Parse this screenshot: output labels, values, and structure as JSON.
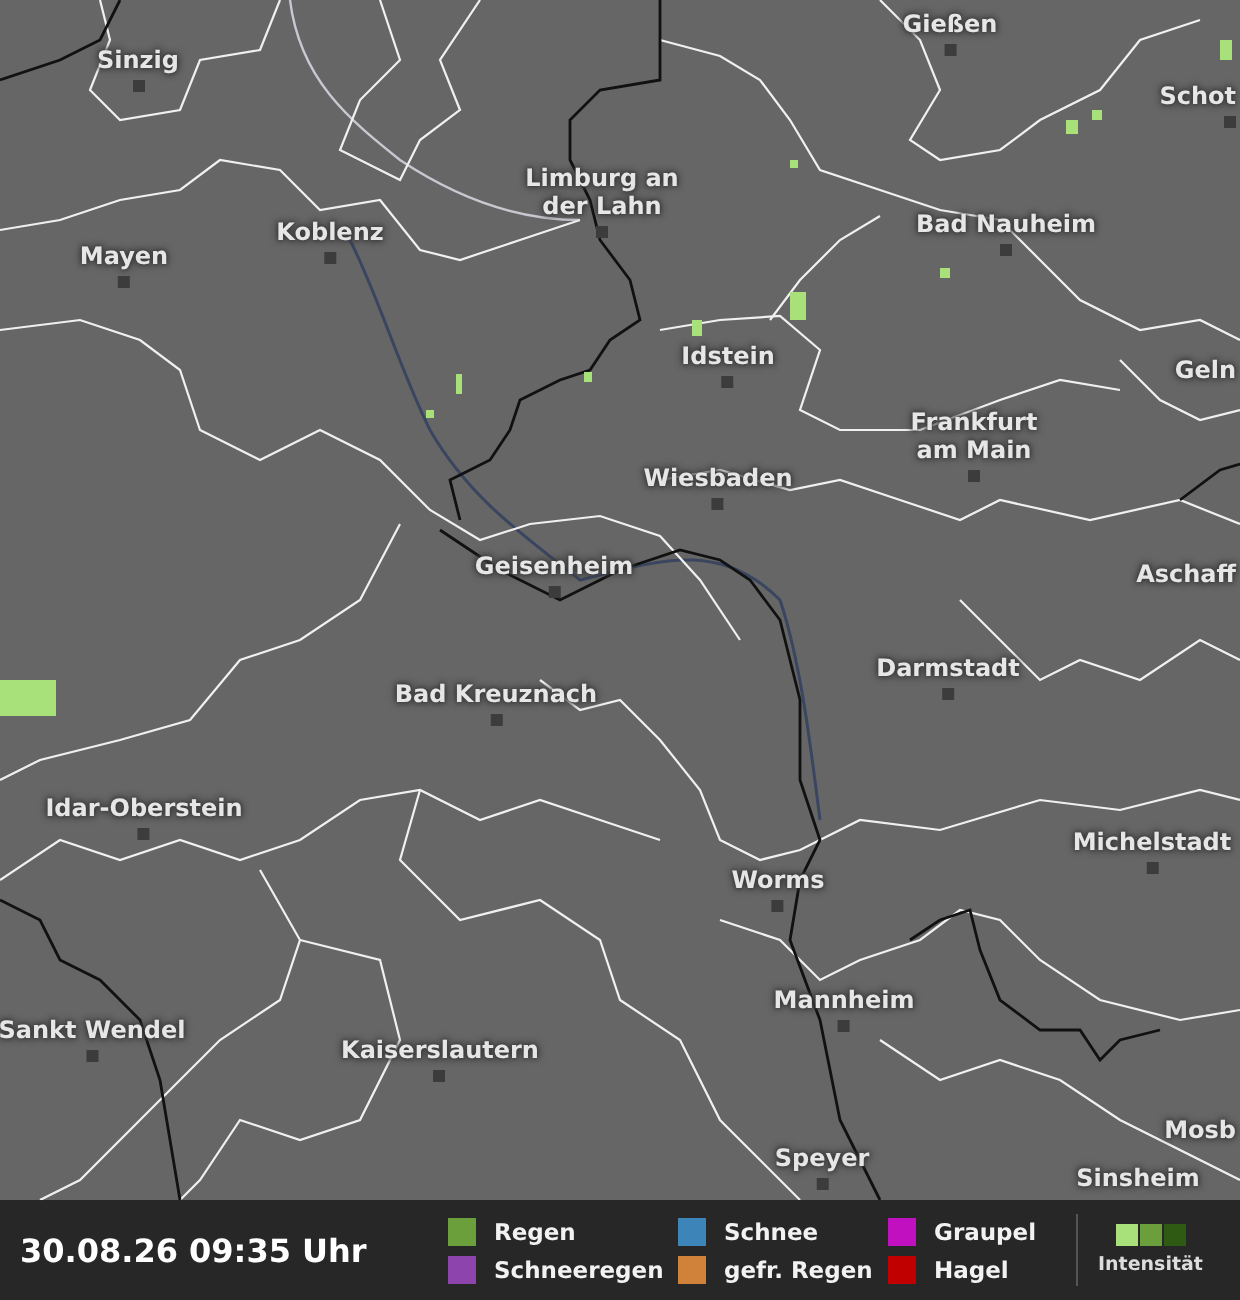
{
  "map": {
    "cities": [
      {
        "name": "Sinzig",
        "marker": true
      },
      {
        "name": "Gießen",
        "marker": true
      },
      {
        "name": "Schot",
        "marker": true
      },
      {
        "name": "Limburg an der Lahn",
        "marker": true
      },
      {
        "name": "Mayen",
        "marker": true
      },
      {
        "name": "Koblenz",
        "marker": true
      },
      {
        "name": "Bad Nauheim",
        "marker": true
      },
      {
        "name": "Idstein",
        "marker": true
      },
      {
        "name": "Geln",
        "marker": false
      },
      {
        "name": "Frankfurt am Main",
        "marker": true
      },
      {
        "name": "Wiesbaden",
        "marker": true
      },
      {
        "name": "Geisenheim",
        "marker": true
      },
      {
        "name": "Aschaff",
        "marker": false
      },
      {
        "name": "Darmstadt",
        "marker": true
      },
      {
        "name": "Bad Kreuznach",
        "marker": true
      },
      {
        "name": "Idar-Oberstein",
        "marker": true
      },
      {
        "name": "Worms",
        "marker": true
      },
      {
        "name": "Michelstadt",
        "marker": true
      },
      {
        "name": "Sankt Wendel",
        "marker": true
      },
      {
        "name": "Mannheim",
        "marker": true
      },
      {
        "name": "Kaiserslautern",
        "marker": true
      },
      {
        "name": "Mosb",
        "marker": false
      },
      {
        "name": "Speyer",
        "marker": true
      },
      {
        "name": "Sinsheim",
        "marker": false
      }
    ]
  },
  "footer": {
    "timestamp": "30.08.26 09:35 Uhr",
    "legend": [
      {
        "label": "Regen",
        "color": "#6a9f3c"
      },
      {
        "label": "Schneeregen",
        "color": "#8e44ad"
      },
      {
        "label": "Schnee",
        "color": "#3d85b8"
      },
      {
        "label": "gefr. Regen",
        "color": "#d0813a"
      },
      {
        "label": "Graupel",
        "color": "#c010c0"
      },
      {
        "label": "Hagel",
        "color": "#c00000"
      }
    ],
    "intensity": {
      "label": "Intensität",
      "steps": [
        {
          "color": "#a8e07a"
        },
        {
          "color": "#6a9f3c"
        },
        {
          "color": "#2e5a14"
        }
      ]
    }
  }
}
